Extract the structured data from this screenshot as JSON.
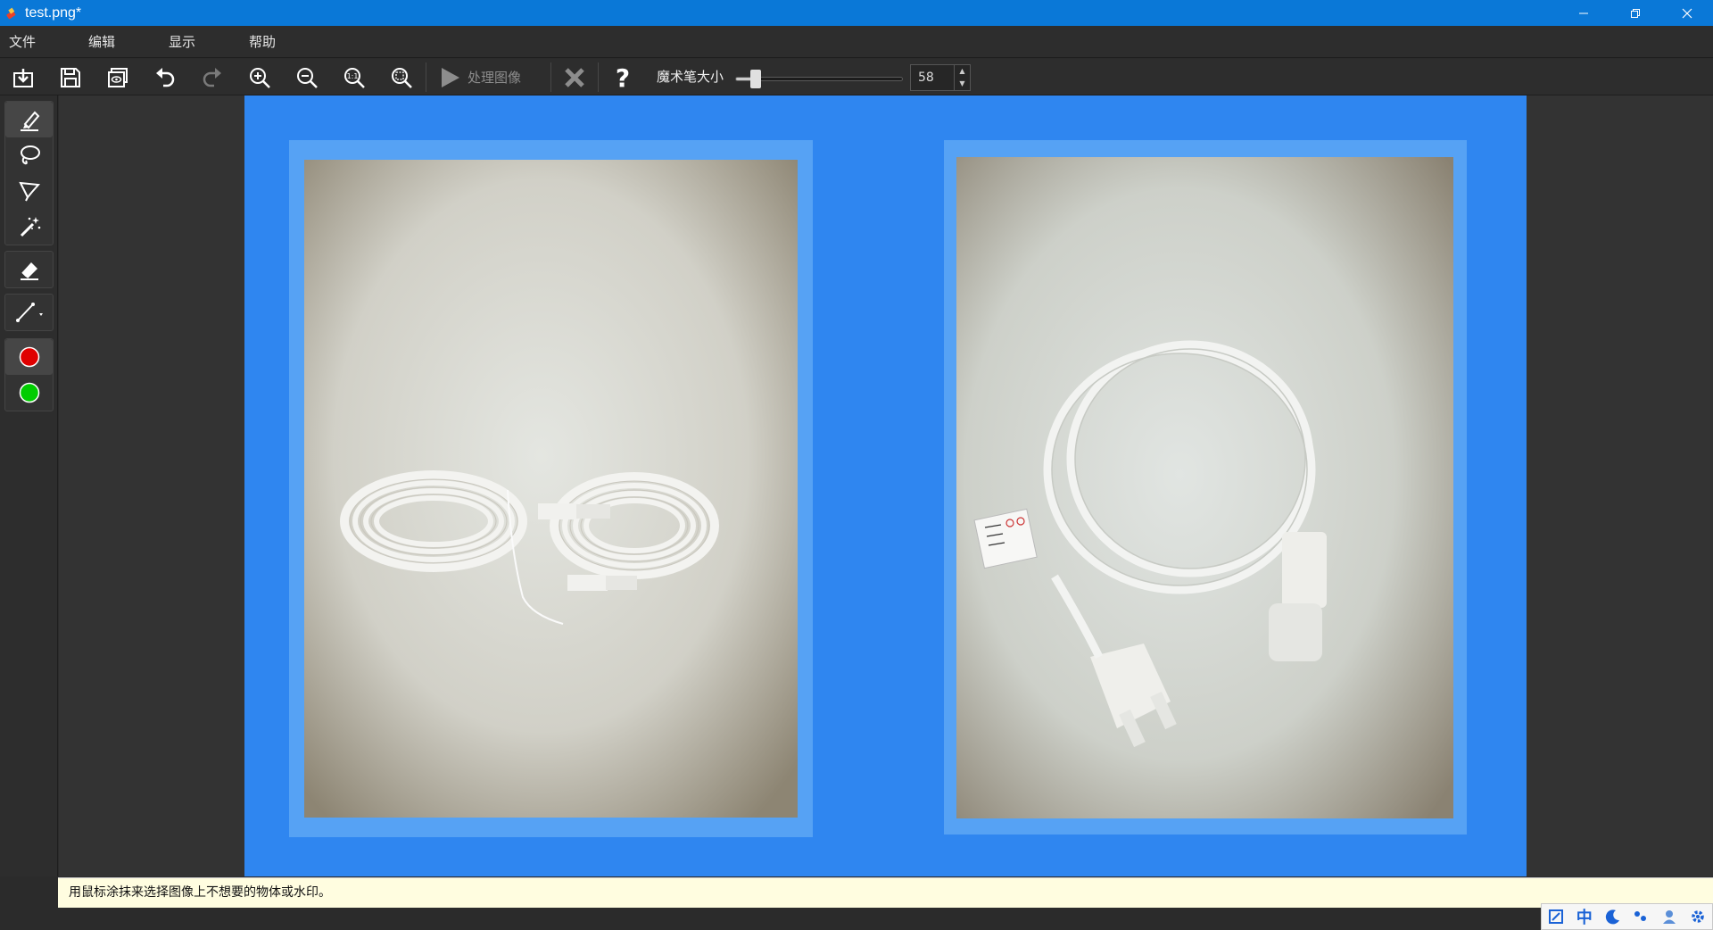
{
  "window": {
    "title": "test.png*"
  },
  "menu": {
    "file": "文件",
    "edit": "编辑",
    "view": "显示",
    "help": "帮助"
  },
  "toolbar": {
    "process_label": "处理图像",
    "brush_size_label": "魔术笔大小",
    "brush_size_value": "58",
    "brush_size_fraction": 0.12
  },
  "status": {
    "message": "用鼠标涂抹来选择图像上不想要的物体或水印。"
  },
  "ime": {
    "lang": "中"
  },
  "colors": {
    "accent": "#0a78d7",
    "canvas_bg": "#2f86f0",
    "tool_red": "#e00000",
    "tool_green": "#00cc00"
  }
}
